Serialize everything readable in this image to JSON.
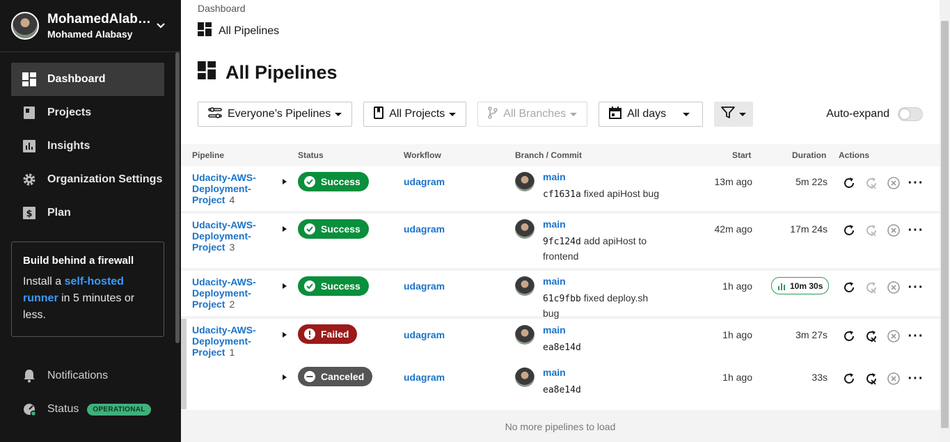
{
  "user": {
    "display_name": "MohamedAlab…",
    "full_name": "Mohamed Alabasy"
  },
  "nav": [
    {
      "label": "Dashboard",
      "icon": "dashboard-icon",
      "active": true
    },
    {
      "label": "Projects",
      "icon": "projects-icon"
    },
    {
      "label": "Insights",
      "icon": "insights-icon"
    },
    {
      "label": "Organization Settings",
      "icon": "gear-icon"
    },
    {
      "label": "Plan",
      "icon": "dollar-icon"
    }
  ],
  "promo": {
    "title": "Build behind a firewall",
    "pre": "Install a ",
    "link": "self-hosted runner",
    "post": " in 5 minutes or less."
  },
  "bottom_nav": [
    {
      "label": "Notifications",
      "icon": "bell-icon"
    },
    {
      "label": "Status",
      "icon": "status-icon",
      "badge": "OPERATIONAL"
    }
  ],
  "breadcrumb": {
    "root": "Dashboard",
    "current": "All Pipelines"
  },
  "page_title": "All Pipelines",
  "filters": {
    "pipelines": "Everyone’s Pipelines",
    "projects": "All Projects",
    "branches": "All Branches",
    "days": "All days"
  },
  "auto_expand_label": "Auto-expand",
  "columns": {
    "pipeline": "Pipeline",
    "status": "Status",
    "workflow": "Workflow",
    "branch": "Branch / Commit",
    "start": "Start",
    "duration": "Duration",
    "actions": "Actions"
  },
  "rows": [
    {
      "project": "Udacity-AWS-Deployment-Project",
      "number": "4",
      "status": "Success",
      "workflow": "udagram",
      "branch": "main",
      "sha": "cf1631a",
      "message": "fixed apiHost bug",
      "start": "13m ago",
      "duration": "5m 22s"
    },
    {
      "project": "Udacity-AWS-Deployment-Project",
      "number": "3",
      "status": "Success",
      "workflow": "udagram",
      "branch": "main",
      "sha": "9fc124d",
      "message": "add apiHost to frontend",
      "start": "42m ago",
      "duration": "17m 24s"
    },
    {
      "project": "Udacity-AWS-Deployment-Project",
      "number": "2",
      "status": "Success",
      "workflow": "udagram",
      "branch": "main",
      "sha": "61c9fbb",
      "message": "fixed deploy.sh bug",
      "start": "1h ago",
      "duration": "10m 30s"
    },
    {
      "project": "Udacity-AWS-Deployment-Project",
      "number": "1",
      "status": "Failed",
      "workflow": "udagram",
      "branch": "main",
      "sha": "ea8e14d",
      "message": "",
      "start": "1h ago",
      "duration": "3m 27s"
    },
    {
      "project": "",
      "number": "",
      "status": "Canceled",
      "workflow": "udagram",
      "branch": "main",
      "sha": "ea8e14d",
      "message": "",
      "start": "1h ago",
      "duration": "33s"
    }
  ],
  "footer_text": "No more pipelines to load",
  "colors": {
    "success": "#0a8f3c",
    "failed": "#9b1a1a",
    "canceled": "#555555",
    "link": "#1a73c8"
  }
}
